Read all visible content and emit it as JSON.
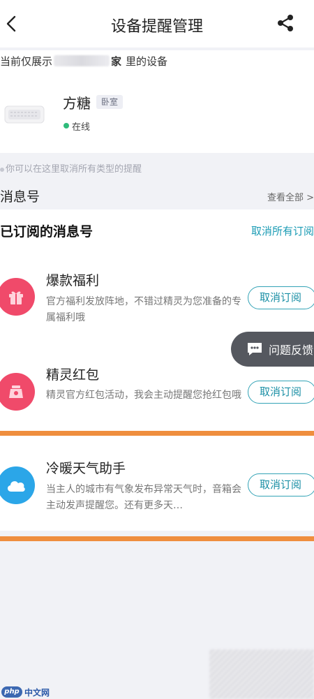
{
  "header": {
    "title": "设备提醒管理"
  },
  "display_scope": {
    "prefix": "当前仅展示",
    "home_name_visible": "家",
    "suffix": "里的设备"
  },
  "device": {
    "name": "方糖",
    "room": "卧室",
    "status": "在线",
    "status_color": "#2fbb7a"
  },
  "hint": "你可以在这里取消所有类型的提醒",
  "message_section": {
    "title": "消息号",
    "view_all": "查看全部 >"
  },
  "subscribed": {
    "title": "已订阅的消息号",
    "unsubscribe_all": "取消所有订阅",
    "items": [
      {
        "title": "爆款福利",
        "desc": "官方福利发放阵地，不错过精灵为您准备的专属福利哦",
        "button": "取消订阅",
        "icon": "gift-icon",
        "icon_color": "#f04a6a"
      },
      {
        "title": "精灵红包",
        "desc": "精灵官方红包活动，我会主动提醒您抢红包哦",
        "button": "取消订阅",
        "icon": "red-packet-icon",
        "icon_color": "#f04a6a"
      },
      {
        "title": "冷暖天气助手",
        "desc": "当主人的城市有气象发布异常天气时，音箱会主动发声提醒您。还有更多天…",
        "button": "取消订阅",
        "icon": "cloud-icon",
        "icon_color": "#2ba6e8"
      }
    ]
  },
  "feedback": {
    "label": "问题反馈"
  },
  "watermark": {
    "badge": "php",
    "text": "中文网"
  },
  "colors": {
    "accent": "#1a9bb4",
    "highlight_bar": "#ef8e3e"
  }
}
